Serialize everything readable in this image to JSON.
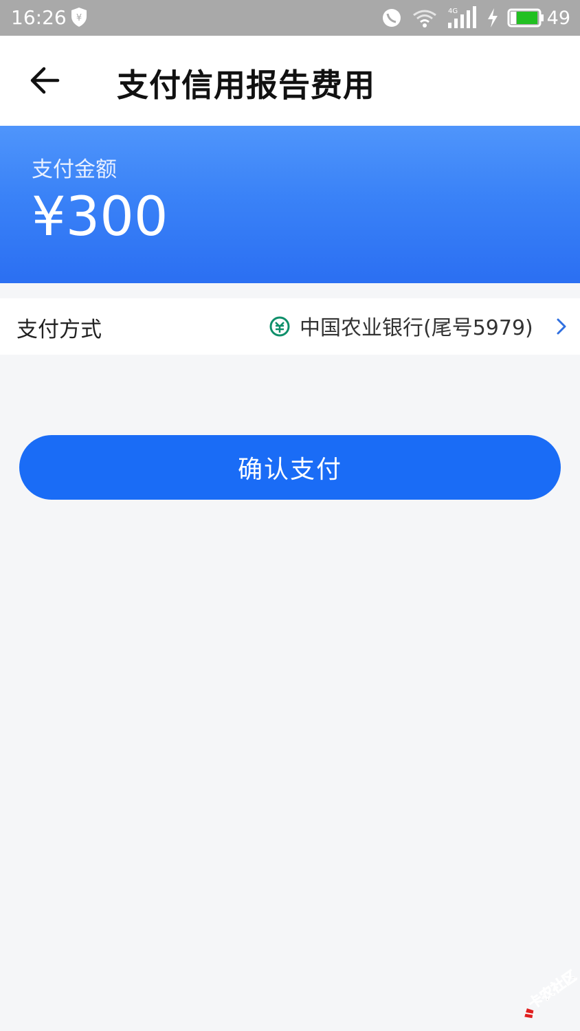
{
  "status_bar": {
    "time": "16:26",
    "network_label": "4G",
    "battery_level": "49",
    "icons": [
      "shield-yen-icon",
      "hd-call-icon",
      "wifi-icon",
      "signal-icon",
      "charging-icon",
      "battery-icon"
    ]
  },
  "header": {
    "back_icon": "back-arrow-icon",
    "title": "支付信用报告费用"
  },
  "amount_panel": {
    "label": "支付金额",
    "value": "¥300",
    "colors": {
      "gradient_top": "#4f95fb",
      "gradient_bottom": "#2b6ff2"
    }
  },
  "payment_method": {
    "label": "支付方式",
    "bank_icon": "abc-bank-icon",
    "bank_name": "中国农业银行(尾号5979)",
    "chevron_icon": "chevron-right-icon"
  },
  "confirm": {
    "label": "确认支付",
    "color": "#1a6cf6"
  },
  "watermark": {
    "text": "卡农社区"
  }
}
